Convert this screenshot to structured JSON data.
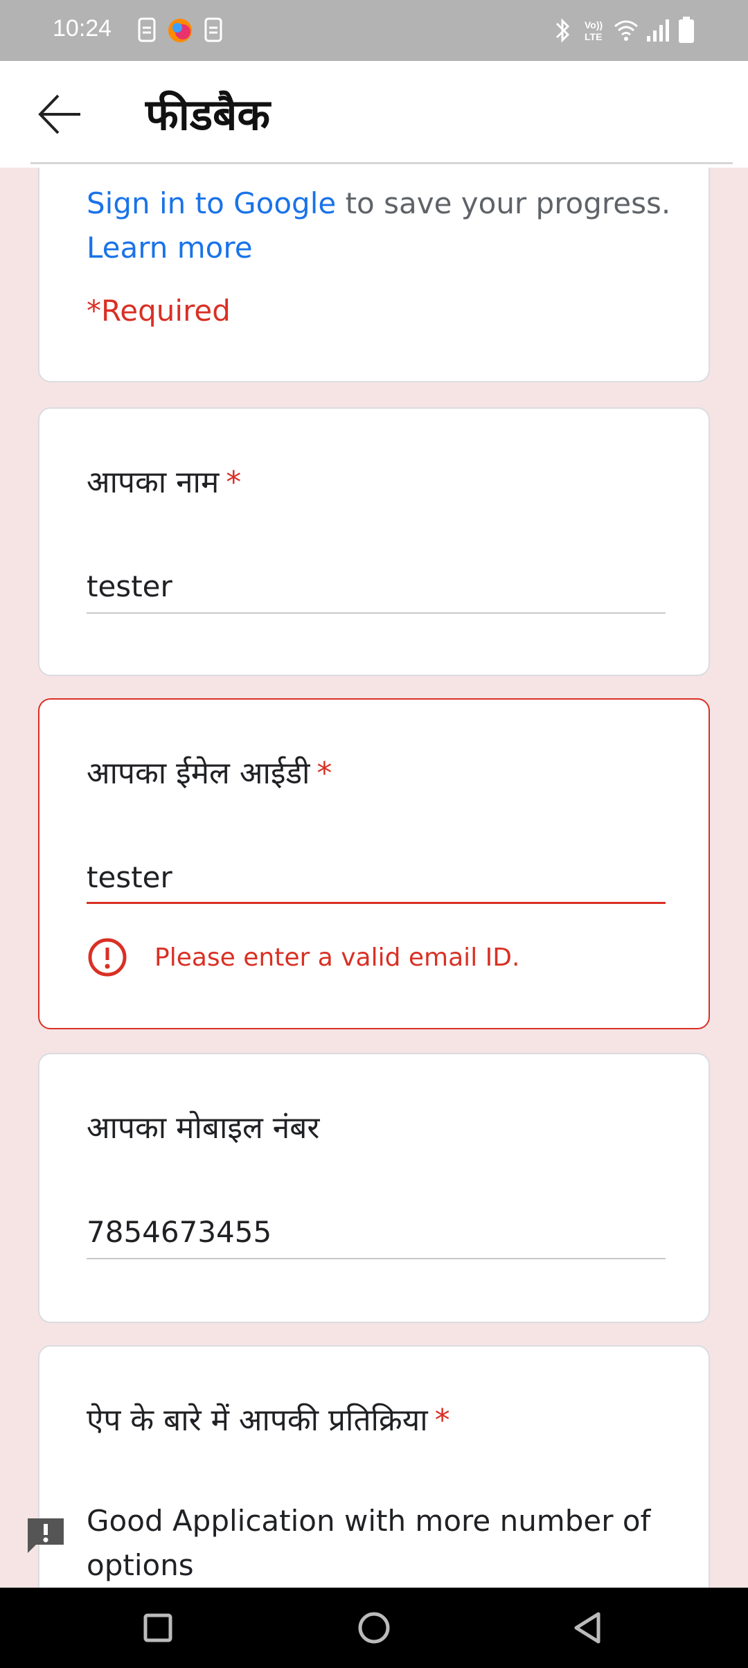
{
  "status_bar": {
    "time": "10:24",
    "icons": [
      "sim-icon",
      "app-icon",
      "sim-icon",
      "bluetooth-icon",
      "volte-icon",
      "wifi-icon",
      "signal-icon",
      "battery-icon"
    ]
  },
  "app_bar": {
    "title": "फीडबैक",
    "back_icon": "arrow-left-icon"
  },
  "intro": {
    "sign_in_link": "Sign in to Google",
    "sign_in_rest": " to save your progress.",
    "learn_more": "Learn more",
    "required_note": "*Required"
  },
  "questions": [
    {
      "label": "आपका नाम",
      "required_mark": "*",
      "value": "tester"
    },
    {
      "label": "आपका ईमेल आईडी",
      "required_mark": "*",
      "value": "tester",
      "error": "Please enter a valid email ID."
    },
    {
      "label": "आपका मोबाइल नंबर",
      "value": "7854673455"
    },
    {
      "label": "ऐप के बारे में आपकी प्रतिक्रिया",
      "required_mark": "*",
      "value_line1": "Good Application with more number of",
      "value_line2": "options"
    }
  ],
  "colors": {
    "accent": "#1a73e8",
    "error": "#d93025",
    "background": "#f6e4e5"
  },
  "nav_bar": {
    "icons": [
      "recents-square-icon",
      "home-circle-icon",
      "back-triangle-icon"
    ]
  }
}
